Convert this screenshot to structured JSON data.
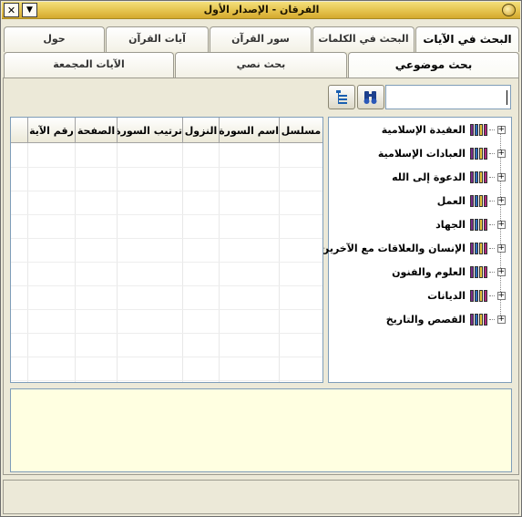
{
  "window": {
    "title": "الفرقان - الإصدار الأول",
    "minimize_glyph": "▼",
    "close_glyph": "✕"
  },
  "tabs_row1": [
    {
      "label": "البحث في الآيات",
      "active": true
    },
    {
      "label": "البحث في الكلمات",
      "active": false
    },
    {
      "label": "سور القرآن",
      "active": false
    },
    {
      "label": "آيات القرآن",
      "active": false
    },
    {
      "label": "حول",
      "active": false
    }
  ],
  "tabs_row2": [
    {
      "label": "بحث موضوعي",
      "active": true
    },
    {
      "label": "بحث نصي",
      "active": false
    },
    {
      "label": "الآيات المجمعة",
      "active": false
    }
  ],
  "search": {
    "value": "",
    "placeholder": ""
  },
  "icons": {
    "binoculars": "binoculars-icon",
    "tree_toggle": "tree-view-icon"
  },
  "tree": {
    "items": [
      "العقيدة الإسلامية",
      "العبادات الإسلامية",
      "الدعوة إلى الله",
      "العمل",
      "الجهاد",
      "الإنسان والعلاقات مع الآخرين",
      "العلوم والفنون",
      "الديانات",
      "القصص والتاريخ"
    ],
    "expander_glyph": "+"
  },
  "grid": {
    "columns": [
      "مسلسل",
      "اسم السورة",
      "النزول",
      "ترتيب السورة",
      "الصفحة",
      "رقم الآية"
    ],
    "rows": []
  },
  "details": {
    "text": ""
  },
  "status": {
    "text": ""
  },
  "colors": {
    "titlebar": "#e3c04a",
    "details_bg": "#ffffe1",
    "chrome_bg": "#ece9d8",
    "book_colors": [
      "#b0287c",
      "#e6c23a",
      "#2f6fbf",
      "#7a2a8a"
    ]
  }
}
